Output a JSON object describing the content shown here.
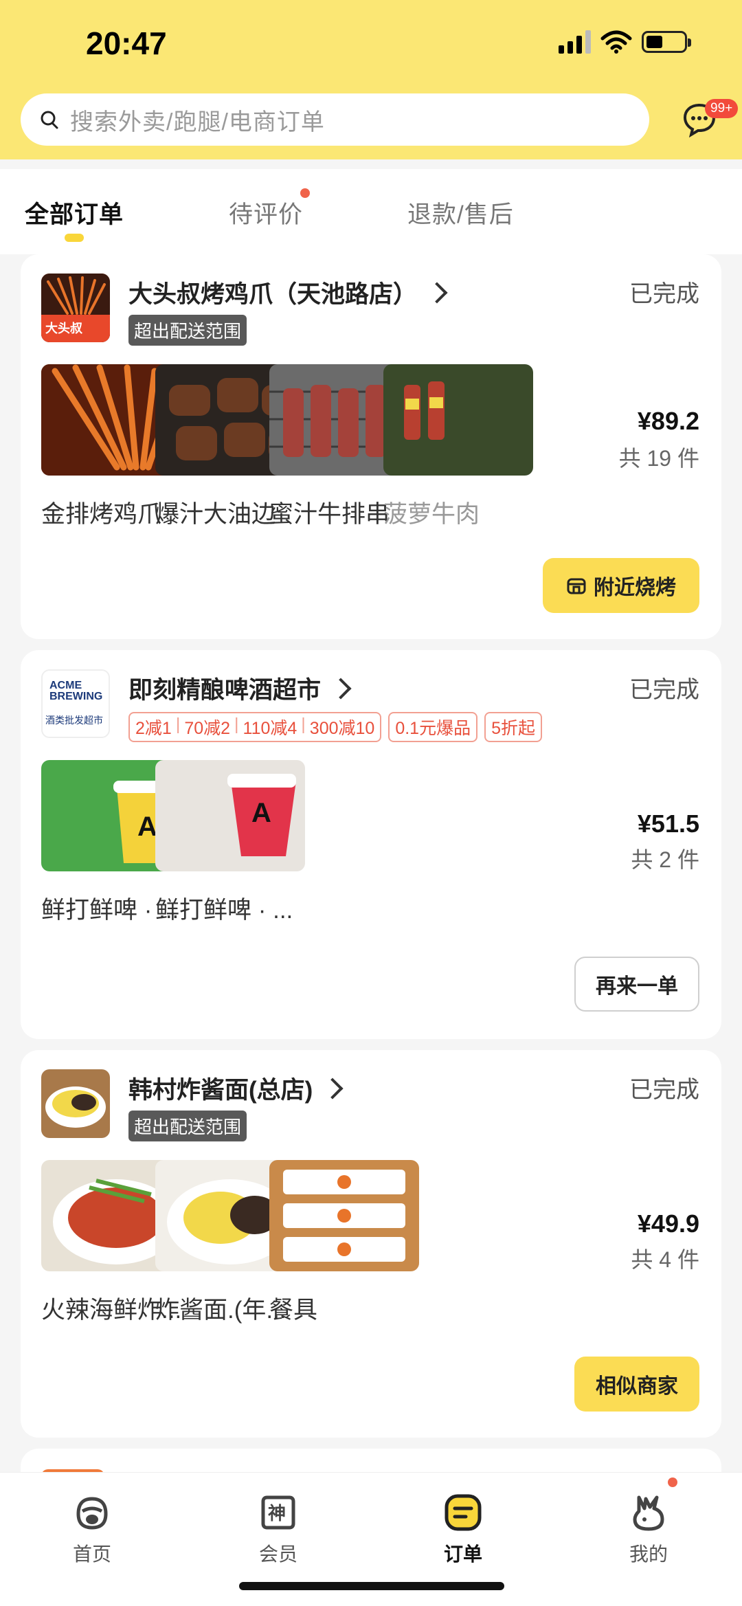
{
  "status_bar": {
    "time": "20:47"
  },
  "search": {
    "placeholder": "搜索外卖/跑腿/电商订单"
  },
  "header": {
    "message_badge": "99+"
  },
  "tabs": [
    {
      "label": "全部订单",
      "active": true
    },
    {
      "label": "待评价",
      "active": false
    },
    {
      "label": "退款/售后",
      "active": false
    }
  ],
  "orders": [
    {
      "store": "大头叔烤鸡爪（天池路店）",
      "status": "已完成",
      "tag": "超出配送范围",
      "logo_text": "大头叔",
      "items": [
        "金排烤鸡爪",
        "爆汁大油边",
        "蜜汁牛排串",
        "菠萝牛肉串"
      ],
      "price": "¥89.2",
      "count": "共 19 件",
      "button": "附近烧烤"
    },
    {
      "store": "即刻精酿啤酒超市",
      "status": "已完成",
      "logo_text": "ACME BREWING",
      "logo_subtext": "酒类批发超市",
      "promos": [
        "2减1",
        "70减2",
        "110减4",
        "300减10",
        "0.1元爆品",
        "5折起"
      ],
      "items": [
        "鲜打鲜啤 · ...",
        "鲜打鲜啤 · ..."
      ],
      "price": "¥51.5",
      "count": "共 2 件",
      "button": "再来一单"
    },
    {
      "store": "韩村炸酱面(总店)",
      "status": "已完成",
      "tag": "超出配送范围",
      "items": [
        "火辣海鲜炸...",
        "炸酱面.(年...",
        "餐具"
      ],
      "price": "¥49.9",
      "count": "共 4 件",
      "button": "相似商家"
    }
  ],
  "tabbar": [
    {
      "label": "首页",
      "icon": "home-face-icon",
      "active": false
    },
    {
      "label": "会员",
      "icon": "member-shen-icon",
      "active": false
    },
    {
      "label": "订单",
      "icon": "order-list-icon",
      "active": true
    },
    {
      "label": "我的",
      "icon": "rabbit-profile-icon",
      "active": false
    }
  ]
}
